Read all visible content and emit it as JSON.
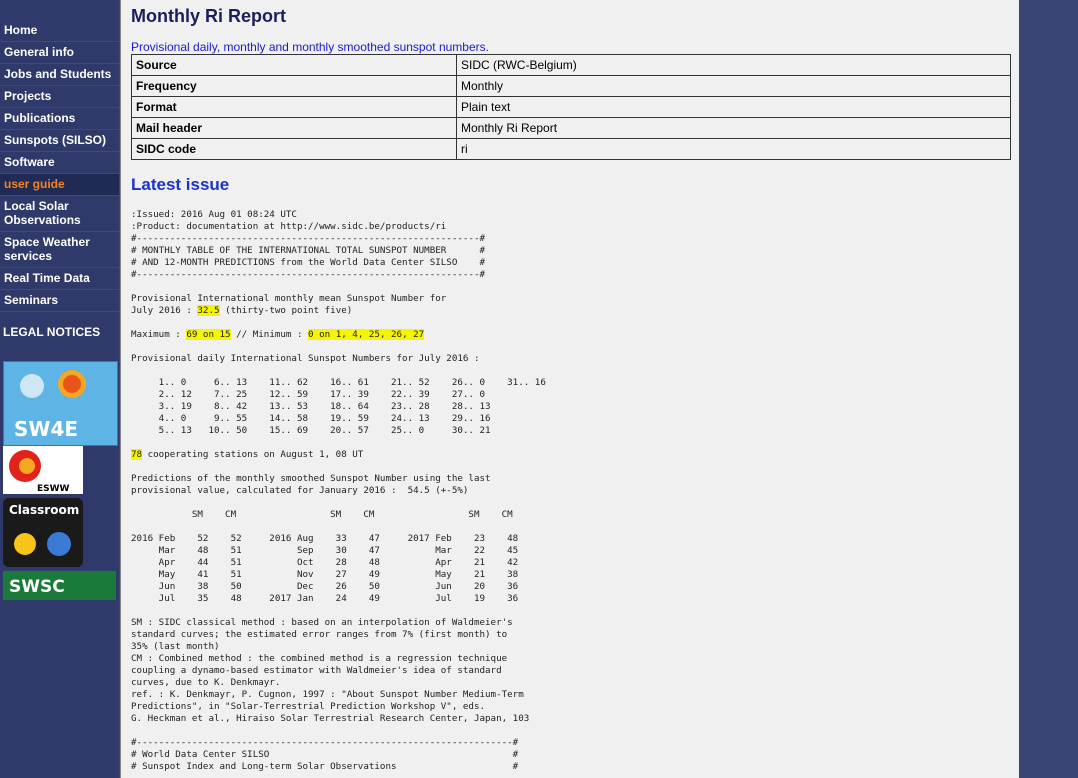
{
  "sidebar": {
    "items": [
      {
        "label": "Home"
      },
      {
        "label": "General info"
      },
      {
        "label": "Jobs and Students"
      },
      {
        "label": "Projects"
      },
      {
        "label": "Publications"
      },
      {
        "label": "Sunspots (SILSO)"
      },
      {
        "label": "Software"
      },
      {
        "label": "user guide"
      },
      {
        "label": "Local Solar Observations"
      },
      {
        "label": "Space Weather services"
      },
      {
        "label": "Real Time Data"
      },
      {
        "label": "Seminars"
      }
    ],
    "legal": "LEGAL NOTICES",
    "logos": [
      "SW4E",
      "ESWW",
      "Classroom",
      "SWSC"
    ]
  },
  "main": {
    "title": "Monthly Ri Report",
    "subtitle": "Provisional daily, monthly and monthly smoothed sunspot numbers.",
    "meta": [
      {
        "k": "Source",
        "v": "SIDC (RWC-Belgium)"
      },
      {
        "k": "Frequency",
        "v": "Monthly"
      },
      {
        "k": "Format",
        "v": "Plain text"
      },
      {
        "k": "Mail header",
        "v": "Monthly Ri Report"
      },
      {
        "k": "SIDC code",
        "v": "ri"
      }
    ],
    "latest_heading": "Latest issue",
    "report": {
      "head": ":Issued: 2016 Aug 01 08:24 UTC\n:Product: documentation at http://www.sidc.be/products/ri\n#--------------------------------------------------------------#\n# MONTHLY TABLE OF THE INTERNATIONAL TOTAL SUNSPOT NUMBER      #\n# AND 12-MONTH PREDICTIONS from the World Data Center SILSO    #\n#--------------------------------------------------------------#\n\nProvisional International monthly mean Sunspot Number for\nJuly 2016 : ",
      "monthly_value": "32.5",
      "monthly_words": " (thirty-two point five)\n\nMaximum : ",
      "maximum": "69 on 15",
      "min_label": " // Minimum : ",
      "minimum": "0 on 1, 4, 25, 26, 27",
      "daily": "\n\nProvisional daily International Sunspot Numbers for July 2016 :\n\n     1.. 0     6.. 13    11.. 62    16.. 61    21.. 52    26.. 0    31.. 16\n     2.. 12    7.. 25    12.. 59    17.. 39    22.. 39    27.. 0\n     3.. 19    8.. 42    13.. 53    18.. 64    23.. 28    28.. 13\n     4.. 0     9.. 55    14.. 58    19.. 59    24.. 13    29.. 16\n     5.. 13   10.. 50    15.. 69    20.. 57    25.. 0     30.. 21\n\n",
      "stations": "78",
      "rest": " cooperating stations on August 1, 08 UT\n\nPredictions of the monthly smoothed Sunspot Number using the last\nprovisional value, calculated for January 2016 :  54.5 (+-5%)\n\n           SM    CM                 SM    CM                 SM    CM\n\n2016 Feb    52    52     2016 Aug    33    47     2017 Feb    23    48\n     Mar    48    51          Sep    30    47          Mar    22    45\n     Apr    44    51          Oct    28    48          Apr    21    42\n     May    41    51          Nov    27    49          May    21    38\n     Jun    38    50          Dec    26    50          Jun    20    36\n     Jul    35    48     2017 Jan    24    49          Jul    19    36\n\nSM : SIDC classical method : based on an interpolation of Waldmeier's\nstandard curves; the estimated error ranges from 7% (first month) to\n35% (last month)\nCM : Combined method : the combined method is a regression technique\ncoupling a dynamo-based estimator with Waldmeier's idea of standard\ncurves, due to K. Denkmayr.\nref. : K. Denkmayr, P. Cugnon, 1997 : \"About Sunspot Number Medium-Term\nPredictions\", in \"Solar-Terrestrial Prediction Workshop V\", eds.\nG. Heckman et al., Hiraiso Solar Terrestrial Research Center, Japan, 103\n\n#--------------------------------------------------------------------#\n# World Data Center SILSO                                            #\n# Sunspot Index and Long-term Solar Observations                     #"
    }
  }
}
